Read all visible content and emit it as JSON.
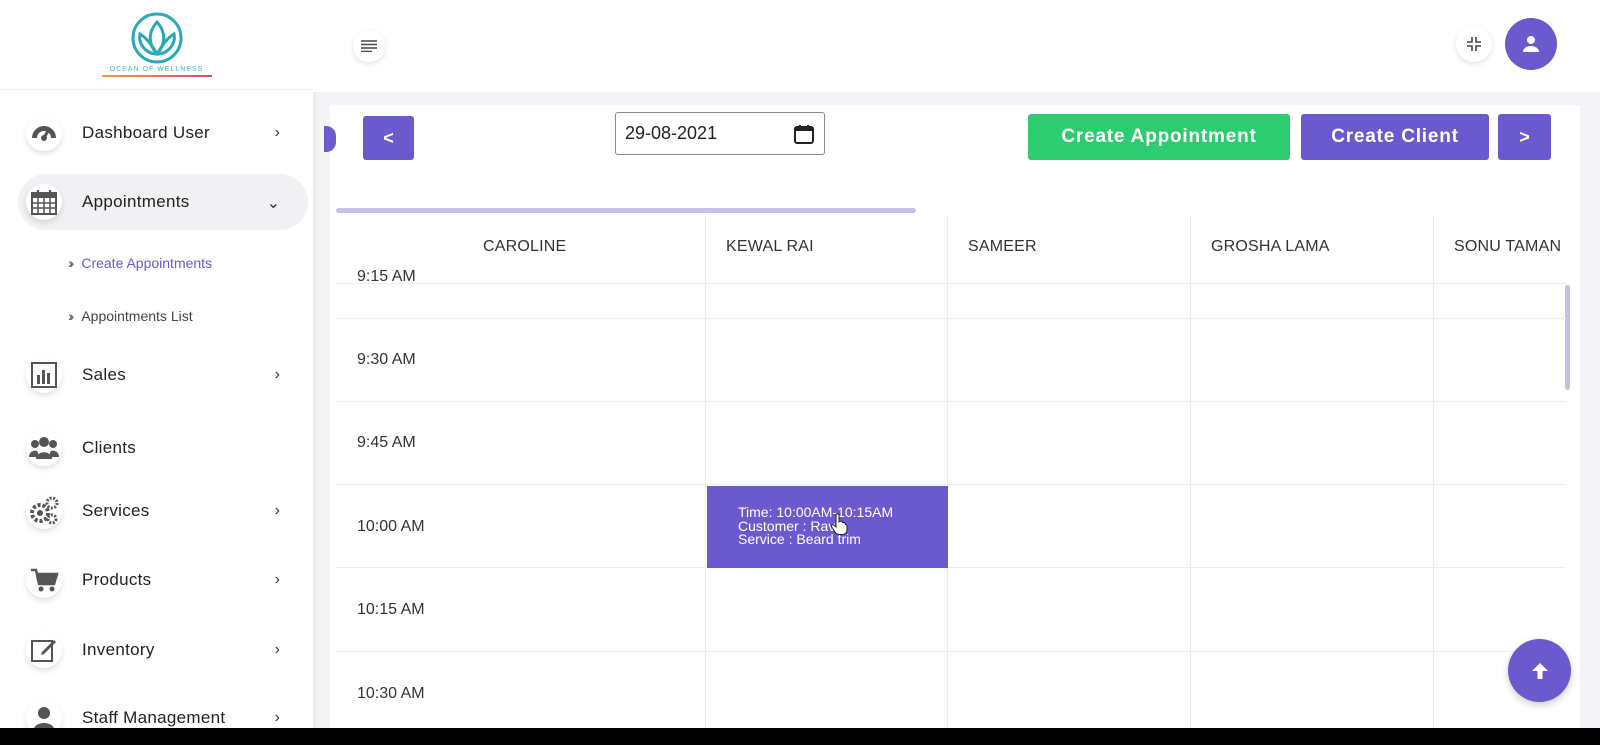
{
  "brand": {
    "logo_text": "OCEAN OF WELLNESS",
    "logo_color": "#2aa8b8"
  },
  "sidebar": {
    "items": [
      {
        "label": "Dashboard User",
        "icon": "dashboard-icon"
      },
      {
        "label": "Appointments",
        "icon": "calendar-icon"
      },
      {
        "label": "Sales",
        "icon": "bar-chart-icon"
      },
      {
        "label": "Clients",
        "icon": "users-icon"
      },
      {
        "label": "Services",
        "icon": "gears-icon"
      },
      {
        "label": "Products",
        "icon": "cart-icon"
      },
      {
        "label": "Inventory",
        "icon": "edit-icon"
      },
      {
        "label": "Staff Management",
        "icon": "user-icon"
      }
    ],
    "sub_items": [
      {
        "label": "Create Appointments"
      },
      {
        "label": "Appointments List"
      }
    ]
  },
  "toolbar": {
    "prev_label": "<",
    "next_label": ">",
    "date_value": "29-08-2021",
    "create_appointment_label": "Create Appointment",
    "create_client_label": "Create Client"
  },
  "calendar": {
    "staff": [
      "CAROLINE",
      "KEWAL RAI",
      "SAMEER",
      "GROSHA LAMA",
      "SONU TAMAN"
    ],
    "times": [
      "9:15 AM",
      "9:30 AM",
      "9:45 AM",
      "10:00 AM",
      "10:15 AM",
      "10:30 AM"
    ],
    "appointment": {
      "time": "Time: 10:00AM-10:15AM",
      "customer": "Customer : Ravi",
      "service": "Service : Beard trim"
    }
  },
  "colors": {
    "accent": "#6a5acd",
    "success": "#2ecc71"
  }
}
